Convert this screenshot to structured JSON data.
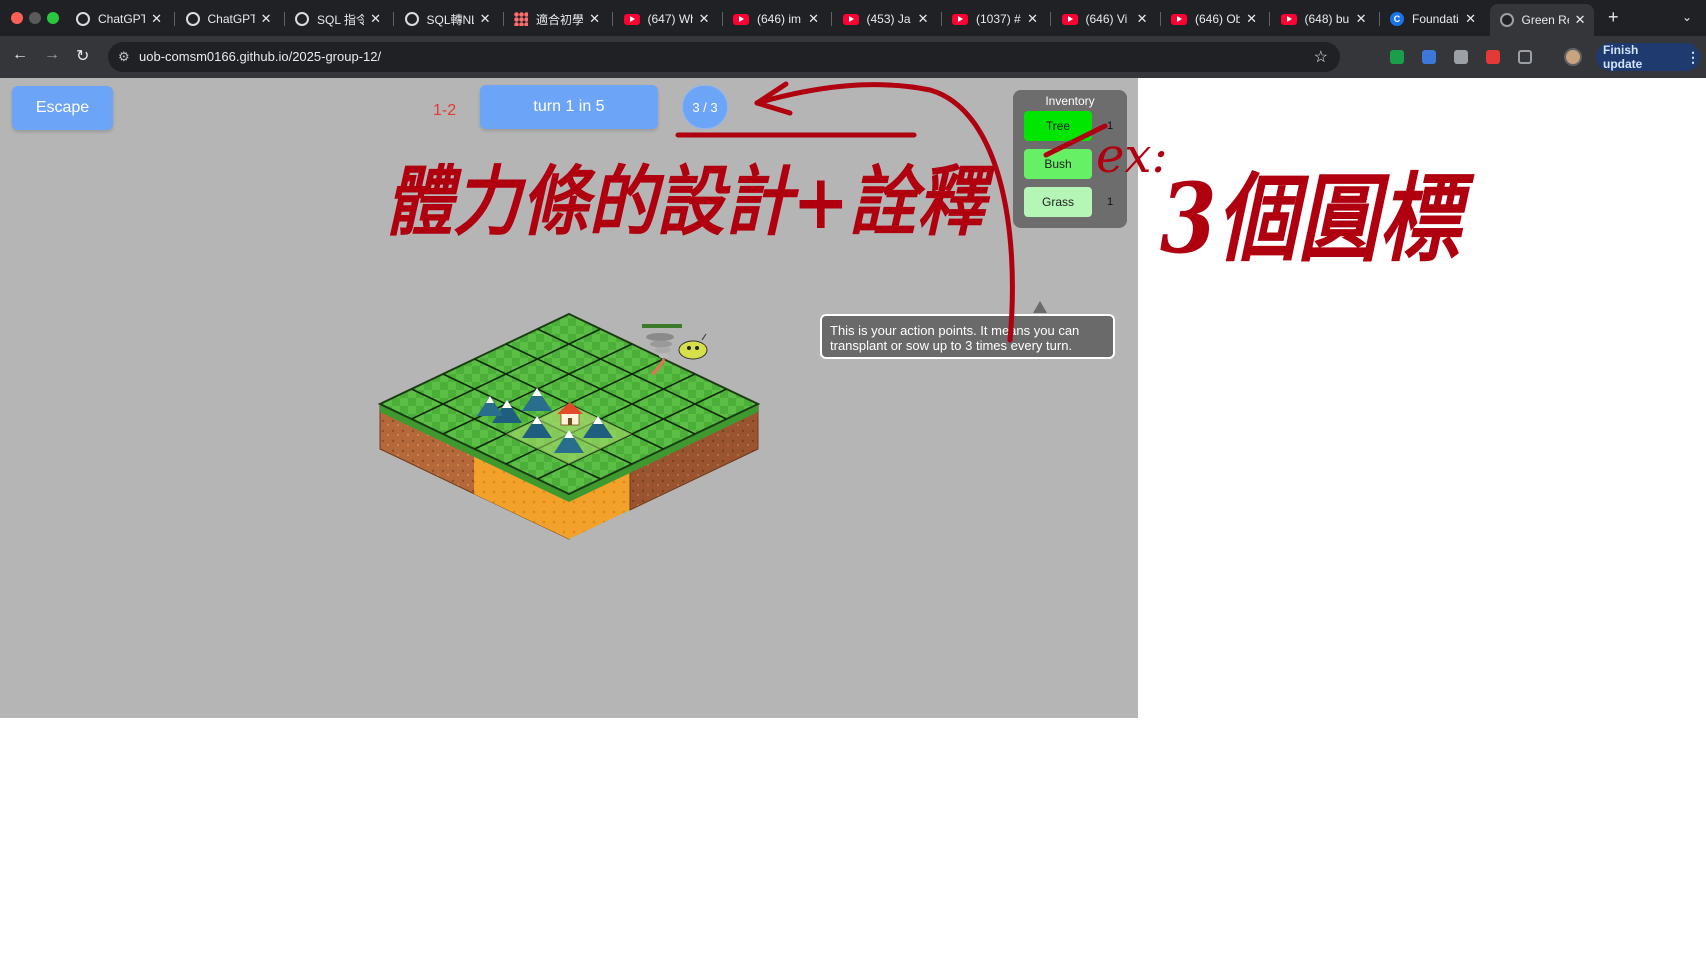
{
  "browser": {
    "tabs": [
      {
        "title": "ChatGPT",
        "icon": "chatgpt-icon"
      },
      {
        "title": "ChatGPT",
        "icon": "chatgpt-icon"
      },
      {
        "title": "SQL 指令",
        "icon": "chatgpt-icon"
      },
      {
        "title": "SQL轉NL",
        "icon": "chatgpt-icon"
      },
      {
        "title": "適合初學",
        "icon": "dots-icon"
      },
      {
        "title": "(647) Wh",
        "icon": "youtube-icon"
      },
      {
        "title": "(646) im",
        "icon": "youtube-icon"
      },
      {
        "title": "(453) Ja",
        "icon": "youtube-icon"
      },
      {
        "title": "(1037) #",
        "icon": "youtube-icon"
      },
      {
        "title": "(646) Vi",
        "icon": "youtube-icon"
      },
      {
        "title": "(646) Ob",
        "icon": "youtube-icon"
      },
      {
        "title": "(648) bu",
        "icon": "youtube-icon"
      },
      {
        "title": "Foundati",
        "icon": "c-icon"
      },
      {
        "title": "Green Re",
        "icon": "globe-icon",
        "active": true
      }
    ],
    "new_tab": "+",
    "url": "uob-comsm0166.github.io/2025-group-12/",
    "finish_update": "Finish update"
  },
  "game": {
    "escape_label": "Escape",
    "level_label": "1-2",
    "turn_label": "turn 1 in 5",
    "action_points": "3 / 3",
    "inventory": {
      "title": "Inventory",
      "items": [
        {
          "name": "Tree",
          "count": "1",
          "color": "#00e600"
        },
        {
          "name": "Bush",
          "count": "",
          "color": "#66f066"
        },
        {
          "name": "Grass",
          "count": "1",
          "color": "#b5f5b5"
        }
      ]
    },
    "tooltip": "This is your action points. It means you can transplant or sow up to 3 times every turn."
  },
  "annotations": {
    "ink_color": "#b00010",
    "handwriting_1": "體力條的設計+詮釋",
    "handwriting_2": "ex:",
    "handwriting_3": "3個圓標"
  }
}
